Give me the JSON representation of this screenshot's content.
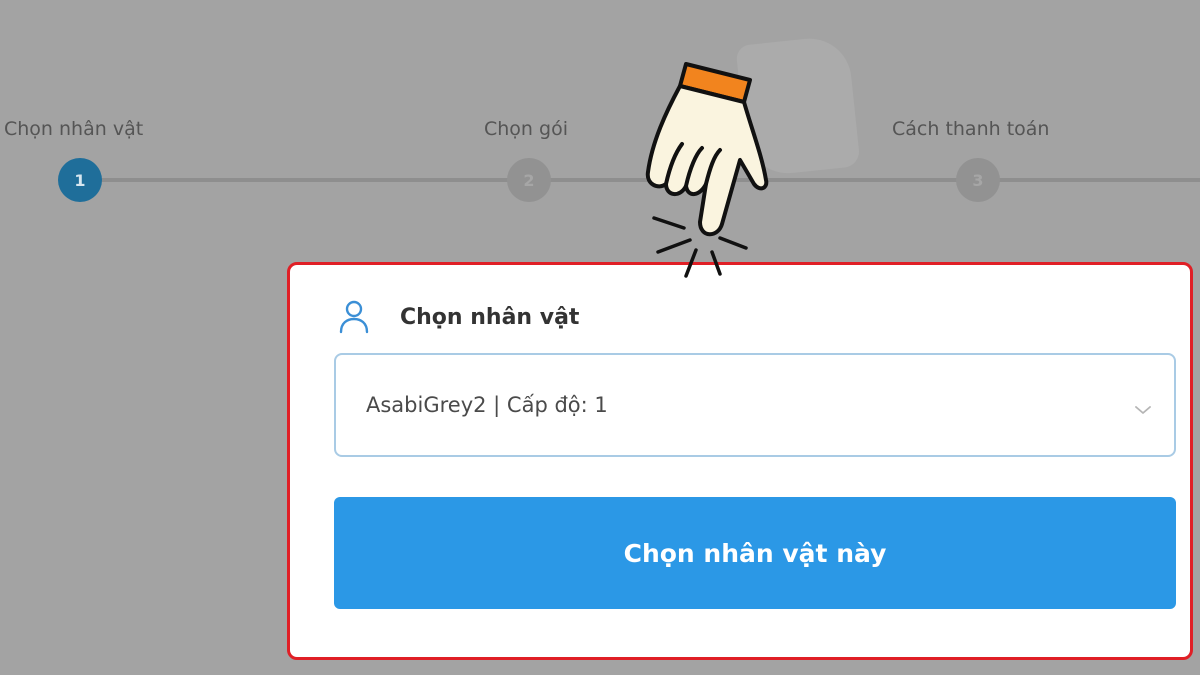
{
  "stepper": {
    "steps": [
      {
        "label": "Chọn nhân vật",
        "number": "1",
        "active": true
      },
      {
        "label": "Chọn gói",
        "number": "2",
        "active": false
      },
      {
        "label": "Cách thanh toán",
        "number": "3",
        "active": false
      }
    ]
  },
  "card": {
    "icon": "user-icon",
    "title": "Chọn nhân vật",
    "select": {
      "value": "AsabiGrey2 | Cấp độ: 1",
      "icon": "chevron-down-icon"
    },
    "button_label": "Chọn nhân vật này",
    "highlight_color": "#e01f26"
  },
  "overlay": {
    "icon": "pointing-hand-icon"
  },
  "colors": {
    "accent": "#2b98e6",
    "step_active": "#1f6e9a"
  }
}
